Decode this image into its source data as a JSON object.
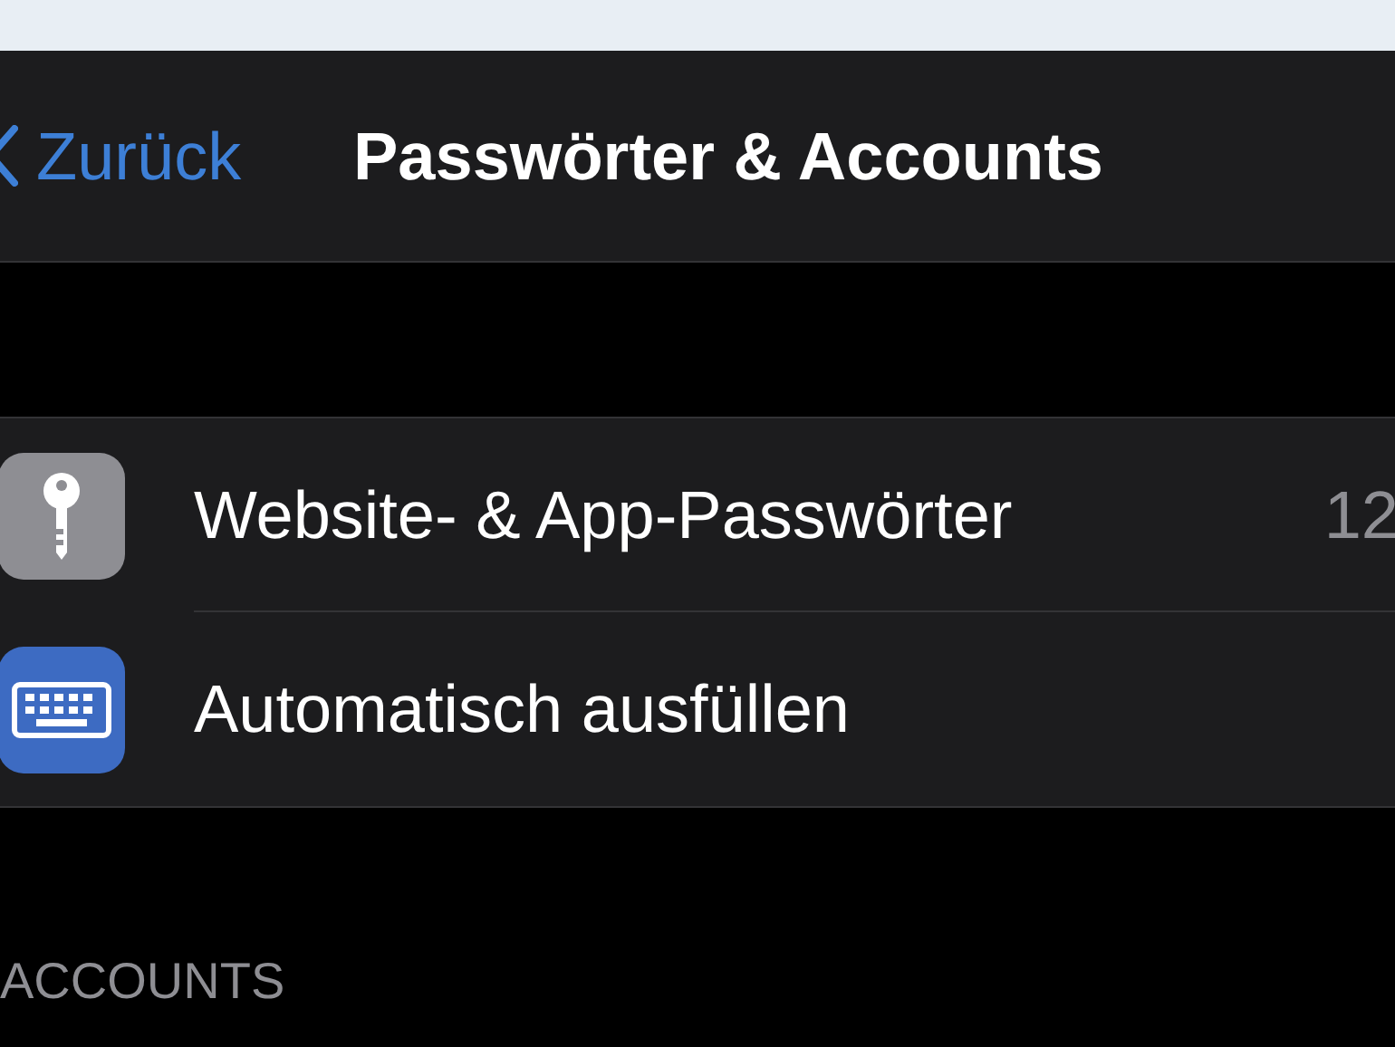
{
  "nav": {
    "back": "Zurück",
    "title": "Passwörter & Accounts"
  },
  "rows": [
    {
      "kind": "key",
      "label": "Website- & App-Passwörter",
      "value": "12"
    },
    {
      "kind": "keyboard",
      "label": "Automatisch ausfüllen"
    }
  ],
  "section_header": "ACCOUNTS"
}
